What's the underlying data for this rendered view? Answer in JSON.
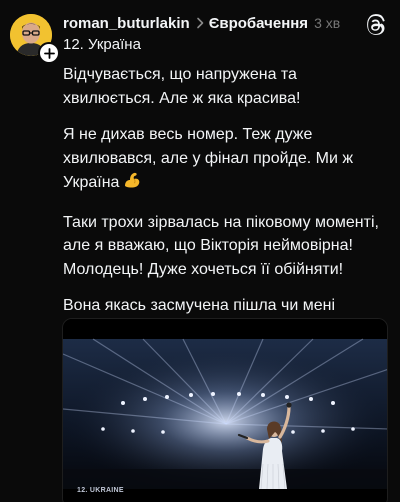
{
  "post": {
    "username": "roman_buturlakin",
    "community": "Євробачення",
    "time_ago": "3 хв",
    "subtitle": "12. Україна",
    "paragraphs": [
      "Відчувається, що напружена та хвилюється. Але ж яка красива!",
      "Я не дихав весь номер. Теж дуже хвилювався, але у фінал пройде. Ми ж Україна",
      "Таки трохи зірвалась на піковому моменті, але я вважаю, що Вікторія неймовірна! Молодець! Дуже хочеться її обійняти!",
      "Вона якась засмучена пішла чи мені здається?"
    ],
    "media_caption": "12. UKRAINE"
  },
  "icons": {
    "header_separator": "chevron-right-icon",
    "app": "threads-logo-icon",
    "follow": "plus-icon",
    "emoji": "flexed-biceps-emoji"
  },
  "colors": {
    "background": "#0a0a0a",
    "text": "#f3f5f7",
    "muted": "#777777",
    "avatar_bg": "#f2c230"
  }
}
